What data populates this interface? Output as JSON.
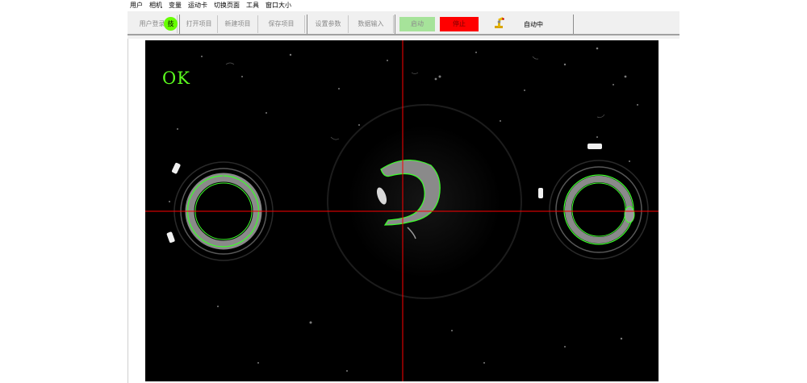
{
  "menu": [
    "用户",
    "相机",
    "变量",
    "运动卡",
    "切换页面",
    "工具",
    "窗口大小"
  ],
  "toolbar": {
    "login_label": "用户登录",
    "badge_label": "技",
    "open_project": "打开项目",
    "new_project": "新建项目",
    "save_project": "保存项目",
    "set_params": "设置参数",
    "data_input": "数据输入",
    "start_label": "启动",
    "stop_label": "停止",
    "status_icon": "robot-arm-icon",
    "status_text": "自动中"
  },
  "colors": {
    "start": "#a6e39a",
    "stop": "#ff0000",
    "badge": "#66ff00",
    "ok": "#5cff1e",
    "crosshair": "#ff0000",
    "contour": "#3cff2a"
  },
  "viewer": {
    "result_text": "OK"
  }
}
